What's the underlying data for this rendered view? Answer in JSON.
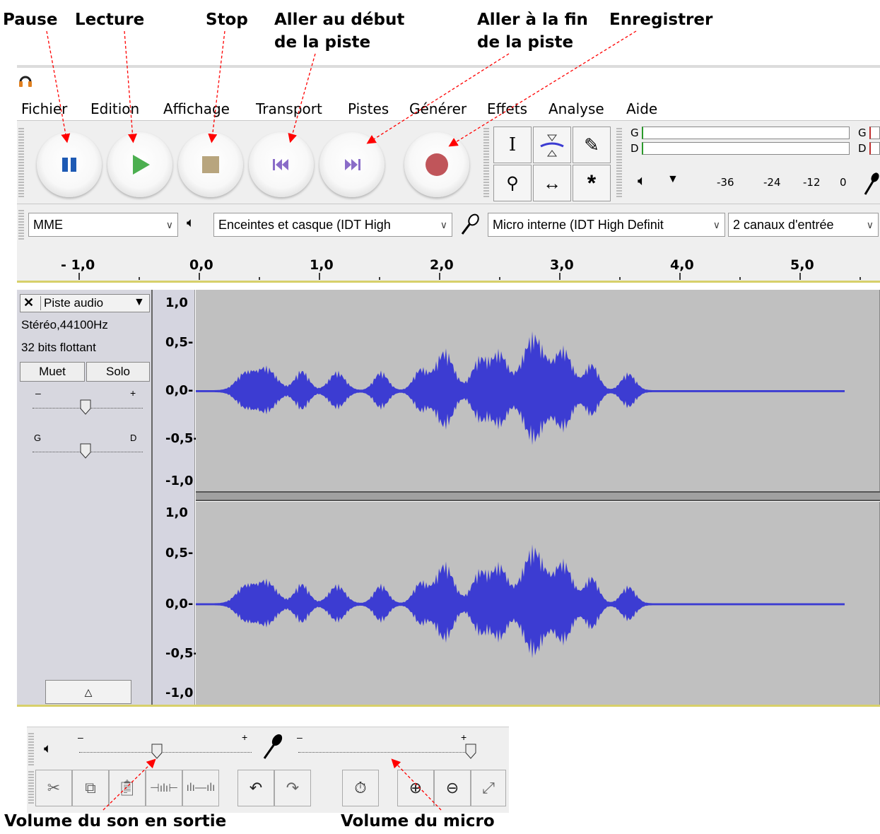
{
  "annotations": {
    "pause": "Pause",
    "play": "Lecture",
    "stop": "Stop",
    "skip_start_1": "Aller au début",
    "skip_start_2": "de la piste",
    "skip_end_1": "Aller à la fin",
    "skip_end_2": "de la piste",
    "record": "Enregistrer",
    "output_volume": "Volume du son en sortie",
    "mic_volume": "Volume du micro"
  },
  "menu": [
    "Fichier",
    "Edition",
    "Affichage",
    "Transport",
    "Pistes",
    "Générer",
    "Effets",
    "Analyse",
    "Aide"
  ],
  "transport": {
    "pause_icon": "pause-icon",
    "play_icon": "play-icon",
    "stop_icon": "stop-icon",
    "skip_start_icon": "skip-start-icon",
    "skip_end_icon": "skip-end-icon",
    "record_icon": "record-icon"
  },
  "meter": {
    "left": "G",
    "right": "D",
    "ticks": [
      "-36",
      "-24",
      "-12",
      "0"
    ]
  },
  "devices": {
    "host": "MME",
    "output": "Enceintes et casque (IDT High",
    "input": "Micro interne (IDT High Definit",
    "channels": "2 canaux d'entrée"
  },
  "ruler": [
    "- 1,0",
    "0,0",
    "1,0",
    "2,0",
    "3,0",
    "4,0",
    "5,0"
  ],
  "track": {
    "name": "Piste audio",
    "format": "Stéréo,44100Hz",
    "bits": "32 bits flottant",
    "mute": "Muet",
    "solo": "Solo",
    "gain_minus": "–",
    "gain_plus": "+",
    "pan_left": "G",
    "pan_right": "D"
  },
  "scale": [
    "1,0",
    "0,5-",
    "0,0-",
    "-0,5-",
    "-1,0"
  ],
  "bottom": {
    "minus": "–",
    "plus": "+",
    "output_volume_level": 0.45,
    "mic_volume_level": 1.0
  },
  "colors": {
    "wave_fill": "#3c3cd2",
    "wave_rms": "#6464e6",
    "wave_bg": "#c0c0c0",
    "arrow": "#ff0000",
    "play_green": "#4caf50",
    "record_red": "#c0555a",
    "pause_blue": "#1e5ab4"
  }
}
